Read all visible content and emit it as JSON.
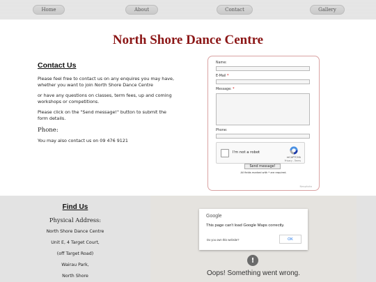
{
  "nav": {
    "items": [
      {
        "label": "Home"
      },
      {
        "label": "About"
      },
      {
        "label": "Contact"
      },
      {
        "label": "Gallery"
      }
    ]
  },
  "title": "North Shore Dance Centre",
  "contact": {
    "heading": "Contact Us",
    "p1": "Please feel free to contact us on any enquires you may have, whether you want to join North Shore Dance Centre",
    "p2": "or have any questions on classes, term fees, up and coming workshops or competitions.",
    "p3": "Please click on the \"Send message!\" button to submit the form details.",
    "phone_heading": "Phone:",
    "phone_text": "You may also contact us on 09 476 9121"
  },
  "form": {
    "name_label": "Name:",
    "email_label": "E-Mail",
    "message_label": "Message:",
    "phone_label": "Phone:",
    "required_mark": "*",
    "captcha_label": "I'm not a robot",
    "captcha_brand": "reCAPTCHA",
    "captcha_links": "Privacy - Terms",
    "send_label": "Send message!",
    "note": "All fields marked with * are required.",
    "credit": "Neophoto"
  },
  "footer": {
    "find_heading": "Find Us",
    "physical_heading": "Physical Address:",
    "address_lines": [
      "North Shore Dance Centre",
      "Unit E, 4 Target Court,",
      "(off Target Road)",
      "Wairau Park,",
      "North Shore"
    ]
  },
  "map": {
    "google_logo": "Google",
    "error_message": "This page can't load Google Maps correctly.",
    "own_site": "Do you own this website?",
    "ok_label": "OK",
    "error_icon": "!",
    "oops": "Oops! Something went wrong."
  }
}
